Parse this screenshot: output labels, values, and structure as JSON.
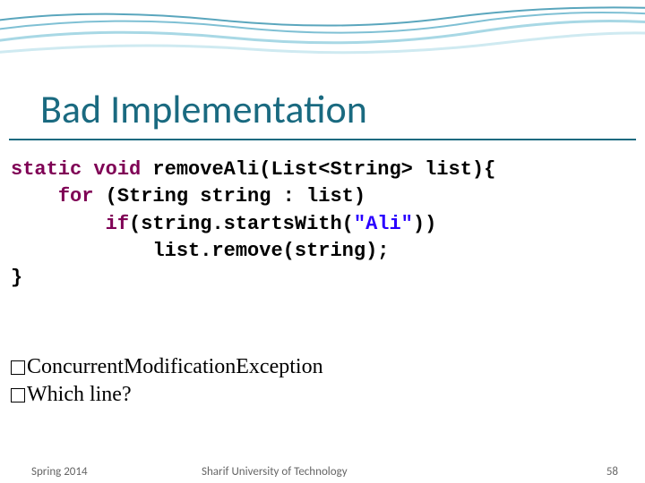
{
  "title": "Bad Implementation",
  "code": {
    "line1": {
      "k1": "static void",
      "t1": " removeAli(List<String> list){"
    },
    "line2": {
      "k1": "for",
      "t1": " (String string : list)"
    },
    "line3": {
      "k1": "if",
      "t1": "(string.startsWith(",
      "s1": "\"Ali\"",
      "t2": "))"
    },
    "line4": {
      "t1": "list.remove(string);"
    },
    "line5": {
      "t1": "}"
    }
  },
  "body": {
    "line1": "ConcurrentModificationException",
    "line2": "Which line?"
  },
  "footer": {
    "left": "Spring 2014",
    "center": "Sharif University of Technology",
    "right": "58"
  }
}
